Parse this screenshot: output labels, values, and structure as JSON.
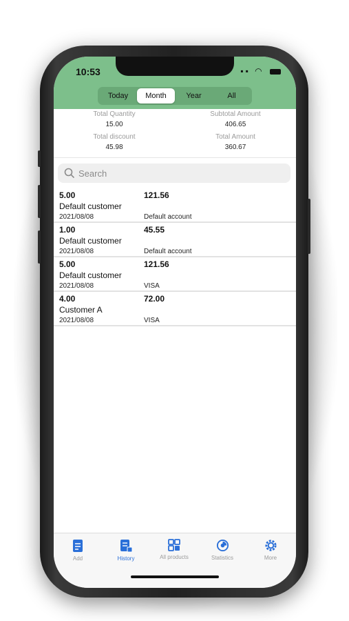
{
  "status_bar": {
    "time": "10:53"
  },
  "segments": [
    {
      "label": "Today",
      "active": false
    },
    {
      "label": "Month",
      "active": true
    },
    {
      "label": "Year",
      "active": false
    },
    {
      "label": "All",
      "active": false
    }
  ],
  "summary": {
    "total_quantity_label": "Total Quantity",
    "total_quantity": "15.00",
    "subtotal_amount_label": "Subtotal Amount",
    "subtotal_amount": "406.65",
    "total_discount_label": "Total discount",
    "total_discount": "45.98",
    "total_amount_label": "Total Amount",
    "total_amount": "360.67"
  },
  "search": {
    "placeholder": "Search",
    "icon": "search-icon"
  },
  "records": [
    {
      "quantity": "5.00",
      "amount": "121.56",
      "customer": "Default customer",
      "date": "2021/08/08",
      "account": "Default account"
    },
    {
      "quantity": "1.00",
      "amount": "45.55",
      "customer": "Default customer",
      "date": "2021/08/08",
      "account": "Default account"
    },
    {
      "quantity": "5.00",
      "amount": "121.56",
      "customer": "Default customer",
      "date": "2021/08/08",
      "account": "VISA"
    },
    {
      "quantity": "4.00",
      "amount": "72.00",
      "customer": "Customer A",
      "date": "2021/08/08",
      "account": "VISA"
    }
  ],
  "tabs": [
    {
      "label": "Add",
      "icon": "add-doc-icon",
      "active": false
    },
    {
      "label": "History",
      "icon": "history-doc-icon",
      "active": true
    },
    {
      "label": "All products",
      "icon": "grid-qr-icon",
      "active": false
    },
    {
      "label": "Statistics",
      "icon": "pie-chart-icon",
      "active": false
    },
    {
      "label": "More",
      "icon": "gear-icon",
      "active": false
    }
  ],
  "colors": {
    "header_bg": "#7dbf8b",
    "tab_accent": "#2a6fd8"
  }
}
